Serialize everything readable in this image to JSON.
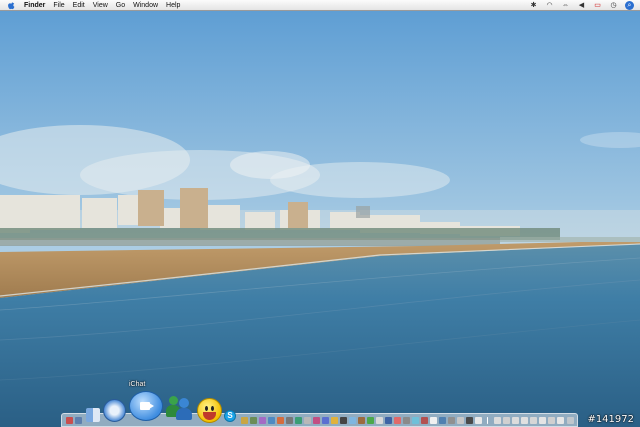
{
  "menubar": {
    "apple_icon": "apple-logo",
    "app_name": "Finder",
    "menus": [
      "File",
      "Edit",
      "View",
      "Go",
      "Window",
      "Help"
    ],
    "status_icons": [
      "bluetooth-icon",
      "wifi-icon",
      "volume-icon",
      "battery-icon",
      "clock-icon",
      "spotlight-icon"
    ]
  },
  "dock": {
    "hover_label": "iChat",
    "apps": [
      "finder-icon",
      "safari-icon",
      "ichat-icon",
      "buddy-icon",
      "smiley-icon",
      "skype-icon"
    ]
  },
  "watermark": "#141972",
  "colors": {
    "sky_top": "#5d9fd6",
    "sky_horizon": "#cfe0ea",
    "sea": "#2f6f98",
    "sand": "#b38b5a"
  }
}
